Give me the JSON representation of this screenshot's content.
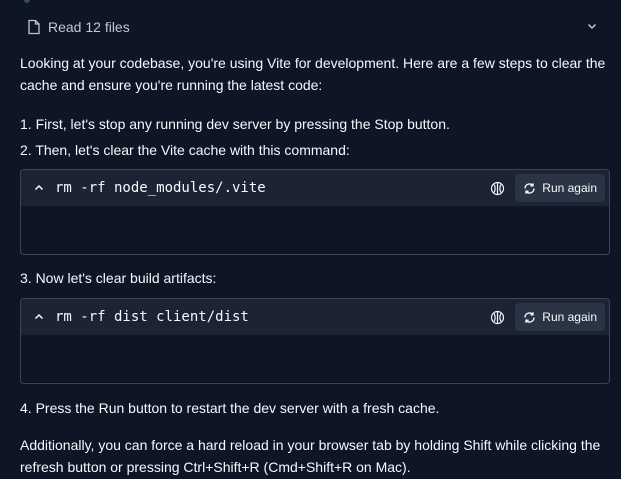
{
  "files_summary": {
    "label": "Read 12 files"
  },
  "intro": "Looking at your codebase, you're using Vite for development. Here are a few steps to clear the cache and ensure you're running the latest code:",
  "steps": {
    "s1": "1. First, let's stop any running dev server by pressing the Stop button.",
    "s2": "2. Then, let's clear the Vite cache with this command:",
    "s3": "3. Now let's clear build artifacts:",
    "s4": "4. Press the Run button to restart the dev server with a fresh cache."
  },
  "code_blocks": [
    {
      "command": "rm -rf node_modules/.vite",
      "button_label": "Run again"
    },
    {
      "command": "rm -rf dist client/dist",
      "button_label": "Run again"
    }
  ],
  "outro": "Additionally, you can force a hard reload in your browser tab by holding Shift while clicking the refresh button or pressing Ctrl+Shift+R (Cmd+Shift+R on Mac).",
  "colors": {
    "background": "#0e1525",
    "code_header": "#1c2333",
    "button_bg": "#2b3445",
    "border": "#3c4554",
    "text": "#f5f9fc",
    "muted_text": "#c2c8cc"
  },
  "icons": [
    "file-icon",
    "chevron-down-icon",
    "chevron-up-icon",
    "shell-icon",
    "rerun-icon"
  ]
}
